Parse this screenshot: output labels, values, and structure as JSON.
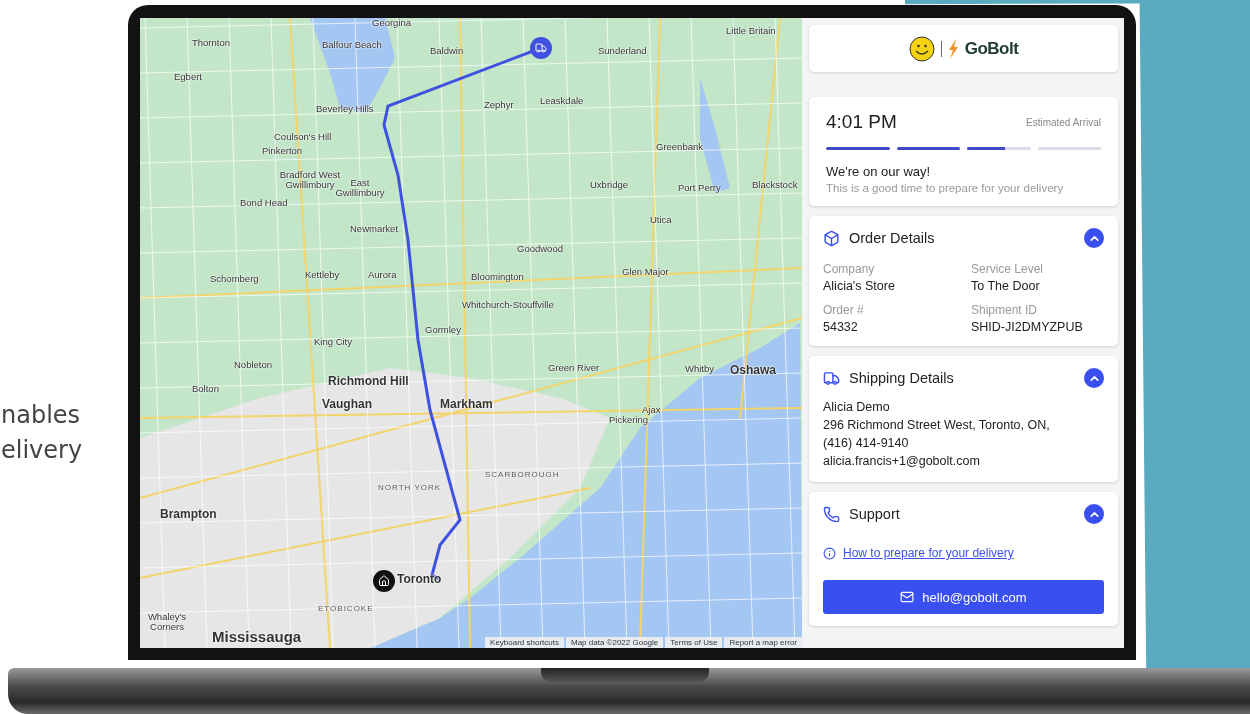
{
  "caption": {
    "lines": [
      "nables",
      "elivery"
    ]
  },
  "map": {
    "labels": [
      {
        "text": "Georgina",
        "kind": "town"
      },
      {
        "text": "Thornton",
        "kind": "town"
      },
      {
        "text": "Balfour Beach",
        "kind": "town"
      },
      {
        "text": "Baldwin",
        "kind": "town"
      },
      {
        "text": "Sunderland",
        "kind": "town"
      },
      {
        "text": "Little Britain",
        "kind": "town"
      },
      {
        "text": "Egbert",
        "kind": "town"
      },
      {
        "text": "Zephyr",
        "kind": "town"
      },
      {
        "text": "Leaskdale",
        "kind": "town"
      },
      {
        "text": "Beverley Hills",
        "kind": "town"
      },
      {
        "text": "Coulson's Hill",
        "kind": "town"
      },
      {
        "text": "Pinkerton",
        "kind": "town"
      },
      {
        "text": "Bradford West Gwillimbury",
        "kind": "town"
      },
      {
        "text": "Bond Head",
        "kind": "town"
      },
      {
        "text": "East Gwillimbury",
        "kind": "town"
      },
      {
        "text": "Greenbank",
        "kind": "town"
      },
      {
        "text": "Uxbridge",
        "kind": "town"
      },
      {
        "text": "Port Perry",
        "kind": "town"
      },
      {
        "text": "Blackstock",
        "kind": "town"
      },
      {
        "text": "Utica",
        "kind": "town"
      },
      {
        "text": "Newmarket",
        "kind": "town"
      },
      {
        "text": "Goodwood",
        "kind": "town"
      },
      {
        "text": "Schomberg",
        "kind": "town"
      },
      {
        "text": "Kettleby",
        "kind": "town"
      },
      {
        "text": "Aurora",
        "kind": "town"
      },
      {
        "text": "Bloomington",
        "kind": "town"
      },
      {
        "text": "Glen Major",
        "kind": "town"
      },
      {
        "text": "Whitchurch-Stouffville",
        "kind": "town"
      },
      {
        "text": "King City",
        "kind": "town"
      },
      {
        "text": "Gormley",
        "kind": "town"
      },
      {
        "text": "Nobleton",
        "kind": "town"
      },
      {
        "text": "Richmond Hill",
        "kind": "city"
      },
      {
        "text": "Green River",
        "kind": "town"
      },
      {
        "text": "Whitby",
        "kind": "town"
      },
      {
        "text": "Oshawa",
        "kind": "city"
      },
      {
        "text": "Bolton",
        "kind": "town"
      },
      {
        "text": "Vaughan",
        "kind": "city"
      },
      {
        "text": "Markham",
        "kind": "city"
      },
      {
        "text": "Ajax",
        "kind": "town"
      },
      {
        "text": "Pickering",
        "kind": "town"
      },
      {
        "text": "SCARBOROUGH",
        "kind": "district"
      },
      {
        "text": "NORTH YORK",
        "kind": "district"
      },
      {
        "text": "Brampton",
        "kind": "city"
      },
      {
        "text": "Toronto",
        "kind": "city"
      },
      {
        "text": "ETOBICOKE",
        "kind": "district"
      },
      {
        "text": "Whaley's Corners",
        "kind": "town"
      },
      {
        "text": "Mississauga",
        "kind": "metro"
      }
    ],
    "attributions": [
      "Keyboard shortcuts",
      "Map data ©2022 Google",
      "Terms of Use",
      "Report a map error"
    ]
  },
  "panel": {
    "brand": "GoBolt",
    "arrival": {
      "time": "4:01 PM",
      "label": "Estimated Arrival",
      "steps": [
        {
          "level": 1
        },
        {
          "level": 1
        },
        {
          "level": 0.6
        },
        {
          "level": 0
        }
      ],
      "status": "We're on our way!",
      "hint": "This is a good time to prepare for your delivery"
    },
    "sections": [
      {
        "kind": "order",
        "title": "Order Details",
        "expanded": true,
        "fields": [
          {
            "label": "Company",
            "value": "Alicia's Store"
          },
          {
            "label": "Service Level",
            "value": "To The Door"
          },
          {
            "label": "Order #",
            "value": "54332"
          },
          {
            "label": "Shipment ID",
            "value": "SHID-JI2DMYZPUB"
          }
        ]
      },
      {
        "kind": "shipping",
        "title": "Shipping Details",
        "expanded": true,
        "lines": [
          "Alicia Demo",
          "296 Richmond Street West, Toronto, ON,",
          "(416) 414-9140",
          "alicia.francis+1@gobolt.com"
        ]
      },
      {
        "kind": "support",
        "title": "Support",
        "expanded": true,
        "link": "How to prepare for your delivery",
        "button": "hello@gobolt.com"
      }
    ]
  }
}
